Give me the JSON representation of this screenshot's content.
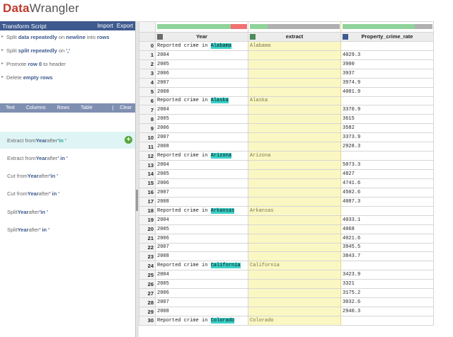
{
  "app": {
    "logo_part1": "Data",
    "logo_part2": "Wrangler"
  },
  "transform_script": {
    "title": "Transform Script",
    "import_label": "Import",
    "export_label": "Export",
    "steps": [
      {
        "p1": "Split ",
        "h1": "data",
        "p2": " ",
        "h2": "repeatedly",
        "p3": " on ",
        "h3": "newline",
        "p4": " into ",
        "h4": "rows"
      },
      {
        "p1": "Split ",
        "h1": "split",
        "p2": " ",
        "h2": "repeatedly",
        "p3": " on ",
        "h3": "','",
        "p4": "",
        "h4": ""
      },
      {
        "p1": "Promote ",
        "h1": "row 0",
        "p2": " to header",
        "h2": "",
        "p3": "",
        "h3": "",
        "p4": "",
        "h4": ""
      },
      {
        "p1": "Delete ",
        "h1": "empty rows",
        "p2": "",
        "h2": "",
        "p3": "",
        "h3": "",
        "p4": "",
        "h4": ""
      }
    ]
  },
  "operations": {
    "text": "Text",
    "columns": "Columns",
    "rows": "Rows",
    "table": "Table",
    "clear": "Clear"
  },
  "suggestions": [
    {
      "pre": "Extract from ",
      "col": "Year",
      "mid": " after ",
      "val": "'in '"
    },
    {
      "pre": "Extract from ",
      "col": "Year",
      "mid": " after ",
      "val": "' in '"
    },
    {
      "pre": "Cut from ",
      "col": "Year",
      "mid": " after ",
      "val": "'in '"
    },
    {
      "pre": "Cut from ",
      "col": "Year",
      "mid": " after ",
      "val": "' in '"
    },
    {
      "pre": "Split ",
      "col": "Year",
      "mid": " after ",
      "val": "'in '"
    },
    {
      "pre": "Split ",
      "col": "Year",
      "mid": " after ",
      "val": "' in '"
    }
  ],
  "grid": {
    "columns": [
      {
        "name": "Year",
        "type_icon": "text-type-icon"
      },
      {
        "name": "extract",
        "type_icon": "geo-type-icon"
      },
      {
        "name": "Property_crime_rate",
        "type_icon": "number-type-icon"
      }
    ],
    "rows": [
      {
        "i": "0",
        "pre": "Reported crime in ",
        "state": "Alabama",
        "ext": "Alabama",
        "rate": ""
      },
      {
        "i": "1",
        "pre": "2004",
        "state": "",
        "ext": "",
        "rate": "4029.3"
      },
      {
        "i": "2",
        "pre": "2005",
        "state": "",
        "ext": "",
        "rate": "3900"
      },
      {
        "i": "3",
        "pre": "2006",
        "state": "",
        "ext": "",
        "rate": "3937"
      },
      {
        "i": "4",
        "pre": "2007",
        "state": "",
        "ext": "",
        "rate": "3974.9"
      },
      {
        "i": "5",
        "pre": "2008",
        "state": "",
        "ext": "",
        "rate": "4081.9"
      },
      {
        "i": "6",
        "pre": "Reported crime in ",
        "state": "Alaska",
        "ext": "Alaska",
        "rate": ""
      },
      {
        "i": "7",
        "pre": "2004",
        "state": "",
        "ext": "",
        "rate": "3370.9"
      },
      {
        "i": "8",
        "pre": "2005",
        "state": "",
        "ext": "",
        "rate": "3615"
      },
      {
        "i": "9",
        "pre": "2006",
        "state": "",
        "ext": "",
        "rate": "3582"
      },
      {
        "i": "10",
        "pre": "2007",
        "state": "",
        "ext": "",
        "rate": "3373.9"
      },
      {
        "i": "11",
        "pre": "2008",
        "state": "",
        "ext": "",
        "rate": "2928.3"
      },
      {
        "i": "12",
        "pre": "Reported crime in ",
        "state": "Arizona",
        "ext": "Arizona",
        "rate": ""
      },
      {
        "i": "13",
        "pre": "2004",
        "state": "",
        "ext": "",
        "rate": "5073.3"
      },
      {
        "i": "14",
        "pre": "2005",
        "state": "",
        "ext": "",
        "rate": "4827"
      },
      {
        "i": "15",
        "pre": "2006",
        "state": "",
        "ext": "",
        "rate": "4741.6"
      },
      {
        "i": "16",
        "pre": "2007",
        "state": "",
        "ext": "",
        "rate": "4502.6"
      },
      {
        "i": "17",
        "pre": "2008",
        "state": "",
        "ext": "",
        "rate": "4087.3"
      },
      {
        "i": "18",
        "pre": "Reported crime in ",
        "state": "Arkansas",
        "ext": "Arkansas",
        "rate": ""
      },
      {
        "i": "19",
        "pre": "2004",
        "state": "",
        "ext": "",
        "rate": "4033.1"
      },
      {
        "i": "20",
        "pre": "2005",
        "state": "",
        "ext": "",
        "rate": "4068"
      },
      {
        "i": "21",
        "pre": "2006",
        "state": "",
        "ext": "",
        "rate": "4021.6"
      },
      {
        "i": "22",
        "pre": "2007",
        "state": "",
        "ext": "",
        "rate": "3945.5"
      },
      {
        "i": "23",
        "pre": "2008",
        "state": "",
        "ext": "",
        "rate": "3843.7"
      },
      {
        "i": "24",
        "pre": "Reported crime in ",
        "state": "California",
        "ext": "California",
        "rate": ""
      },
      {
        "i": "25",
        "pre": "2004",
        "state": "",
        "ext": "",
        "rate": "3423.9"
      },
      {
        "i": "26",
        "pre": "2005",
        "state": "",
        "ext": "",
        "rate": "3321"
      },
      {
        "i": "27",
        "pre": "2006",
        "state": "",
        "ext": "",
        "rate": "3175.2"
      },
      {
        "i": "28",
        "pre": "2007",
        "state": "",
        "ext": "",
        "rate": "3032.6"
      },
      {
        "i": "29",
        "pre": "2008",
        "state": "",
        "ext": "",
        "rate": "2940.3"
      },
      {
        "i": "30",
        "pre": "Reported crime in ",
        "state": "Colorado",
        "ext": "Colorado",
        "rate": ""
      }
    ]
  },
  "colors": {
    "header_bar": "#3e5a8f",
    "ops_bar": "#7f8fb2",
    "selected_suggestion": "#dff4f4",
    "highlight": "#39d0c8",
    "extract_column": "#fbf7c2",
    "quality_valid": "#8fd39a",
    "quality_invalid": "#f27171",
    "quality_empty": "#b0b0b0"
  }
}
